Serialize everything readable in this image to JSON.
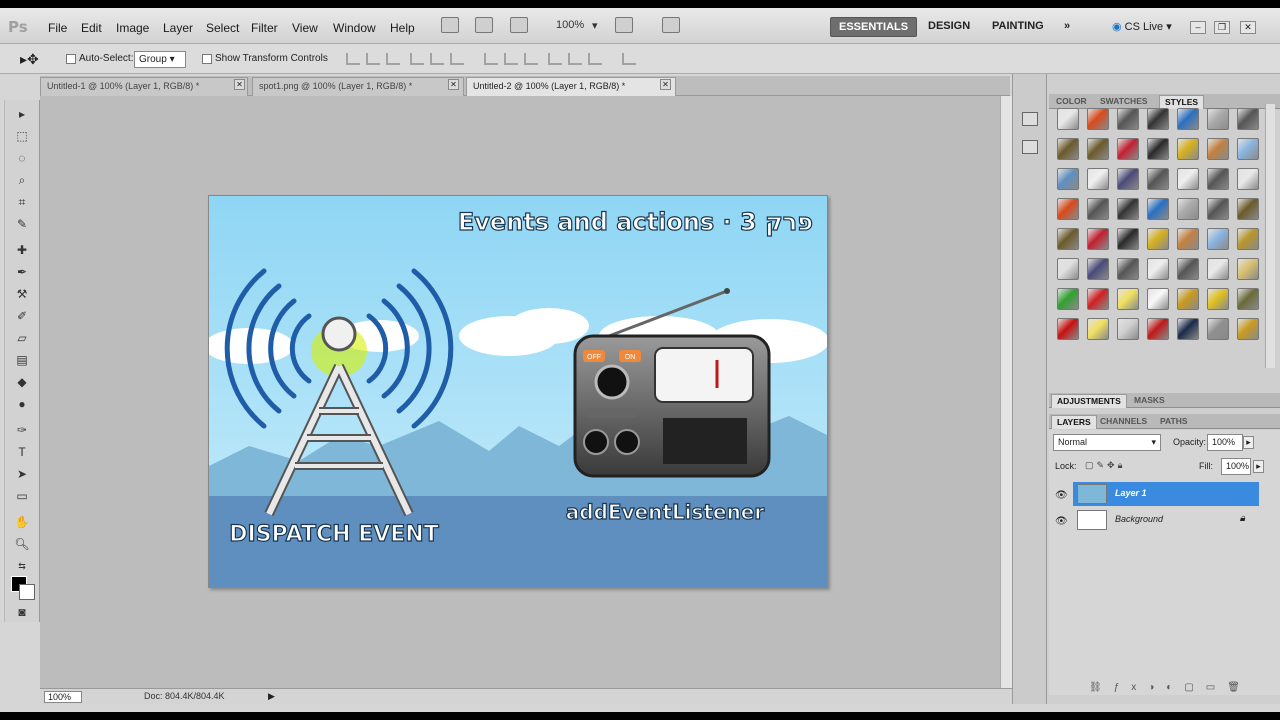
{
  "app": {
    "logo": "Ps"
  },
  "menu": [
    "File",
    "Edit",
    "Image",
    "Layer",
    "Select",
    "Filter",
    "View",
    "Window",
    "Help"
  ],
  "menubar": {
    "zoom": "100%",
    "cs_live": "CS Live"
  },
  "workspaces": {
    "essentials": "ESSENTIALS",
    "design": "DESIGN",
    "painting": "PAINTING",
    "more": "»"
  },
  "options": {
    "auto_select_label": "Auto-Select:",
    "auto_select_value": "Group",
    "show_transform_label": "Show Transform Controls"
  },
  "tabs": [
    {
      "label": "Untitled-1 @ 100% (Layer 1, RGB/8) *",
      "active": false
    },
    {
      "label": "spot1.png @ 100% (Layer 1, RGB/8) *",
      "active": false
    },
    {
      "label": "Untitled-2 @ 100% (Layer 1, RGB/8) *",
      "active": true
    }
  ],
  "canvas": {
    "title": "Events and actions · 3 פרק",
    "dispatch_label": "DISPATCH EVENT",
    "listener_label": "addEventListener",
    "radio_btn_1": "OFF",
    "radio_btn_2": "ON"
  },
  "status": {
    "zoom": "100%",
    "doc": "Doc: 804.4K/804.4K"
  },
  "panels": {
    "top_tabs": [
      "COLOR",
      "SWATCHES",
      "STYLES"
    ],
    "mid_tabs": [
      "ADJUSTMENTS",
      "MASKS"
    ],
    "layer_tabs": [
      "LAYERS",
      "CHANNELS",
      "PATHS"
    ],
    "blend_mode": "Normal",
    "opacity_label": "Opacity:",
    "opacity_value": "100%",
    "lock_label": "Lock:",
    "fill_label": "Fill:",
    "fill_value": "100%"
  },
  "layers": [
    {
      "name": "Layer 1",
      "selected": true
    },
    {
      "name": "Background",
      "selected": false
    }
  ],
  "style_colors": [
    "#e8e8e8",
    "#d84a1c",
    "#555555",
    "#333333",
    "#2a6fc2",
    "#aaaaaa",
    "#555555",
    "#6b5a2a",
    "#6b5a2a",
    "#c22030",
    "#2a2a2a",
    "#d4b020",
    "#c28040",
    "#8ab4e0",
    "#6090c0",
    "#f0f0f0",
    "#4a4a7a",
    "#555555",
    "#eeeeee",
    "#555555",
    "#e8e8e8",
    "#d84a1c",
    "#555555",
    "#333333",
    "#2a6fc2",
    "#aaaaaa",
    "#555555",
    "#6b5a2a",
    "#6b5a2a",
    "#c22030",
    "#2a2a2a",
    "#d4b020",
    "#c28040",
    "#8ab4e0",
    "#b8962a",
    "#e0e0e0",
    "#4a4a7a",
    "#555555",
    "#eeeeee",
    "#555555",
    "#e8e8e8",
    "#d8c070",
    "#30a030",
    "#d02020",
    "#f0e060",
    "#f8f8f8",
    "#c89a20",
    "#e0c020",
    "#6a6a3a",
    "#c81010",
    "#f0e060",
    "#d0d0d0",
    "#c01818",
    "#1a2a4a",
    "#909090",
    "#c89a20",
    "#207a7a",
    "#a01010",
    "#b01818",
    "#c01818",
    "#b01010",
    "#6a2a7a",
    "#505060"
  ]
}
